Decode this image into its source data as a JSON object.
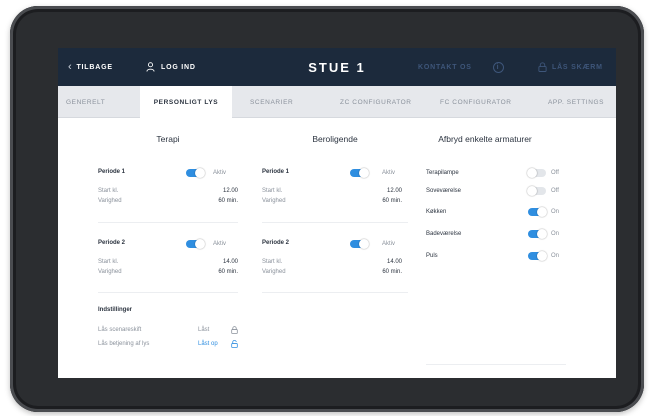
{
  "topbar": {
    "back_label": "TILBAGE",
    "login_label": "LOG IND",
    "room_title": "STUE 1",
    "contact_label": "KONTAKT OS",
    "info_glyph": "i",
    "lock_screen_label": "LÅS SKÆRM"
  },
  "tabs": [
    {
      "label": "GENERELT",
      "active": false
    },
    {
      "label": "PERSONLIGT LYS",
      "active": true
    },
    {
      "label": "SCENARIER",
      "active": false
    },
    {
      "label": "ZC CONFIGURATOR",
      "active": false
    },
    {
      "label": "FC CONFIGURATOR",
      "active": false
    },
    {
      "label": "APP. SETTINGS",
      "active": false
    }
  ],
  "terapi": {
    "heading": "Terapi",
    "periods": [
      {
        "name": "Periode 1",
        "status": "Aktiv",
        "on": true,
        "start_label": "Start kl.",
        "start_value": "12.00",
        "duration_label": "Varighed",
        "duration_value": "60 min."
      },
      {
        "name": "Periode 2",
        "status": "Aktiv",
        "on": true,
        "start_label": "Start kl.",
        "start_value": "14.00",
        "duration_label": "Varighed",
        "duration_value": "60 min."
      }
    ],
    "settings": {
      "title": "Indstillinger",
      "rows": [
        {
          "label": "Lås scenareskift",
          "value": "Låst",
          "state": "locked"
        },
        {
          "label": "Lås betjening af lys",
          "value": "Låst op",
          "state": "unlocked"
        }
      ]
    }
  },
  "beroligende": {
    "heading": "Beroligende",
    "periods": [
      {
        "name": "Periode 1",
        "status": "Aktiv",
        "on": true,
        "start_label": "Start kl.",
        "start_value": "12.00",
        "duration_label": "Varighed",
        "duration_value": "60 min."
      },
      {
        "name": "Periode 2",
        "status": "Aktiv",
        "on": true,
        "start_label": "Start kl.",
        "start_value": "14.00",
        "duration_label": "Varighed",
        "duration_value": "60 min."
      }
    ]
  },
  "fixtures": {
    "heading": "Afbryd enkelte armaturer",
    "items": [
      {
        "name": "Terapilampe",
        "state": "Off",
        "on": false
      },
      {
        "name": "Soveværelse",
        "state": "Off",
        "on": false
      },
      {
        "name": "Køkken",
        "state": "On",
        "on": true
      },
      {
        "name": "Badeværelse",
        "state": "On",
        "on": true
      },
      {
        "name": "Puls",
        "state": "On",
        "on": true
      }
    ]
  },
  "colors": {
    "topbar_bg": "#1c2a3c",
    "accent_blue": "#2f8ee0",
    "tabbar_bg": "#e6e8ec",
    "device_frame": "#2b2d30"
  }
}
